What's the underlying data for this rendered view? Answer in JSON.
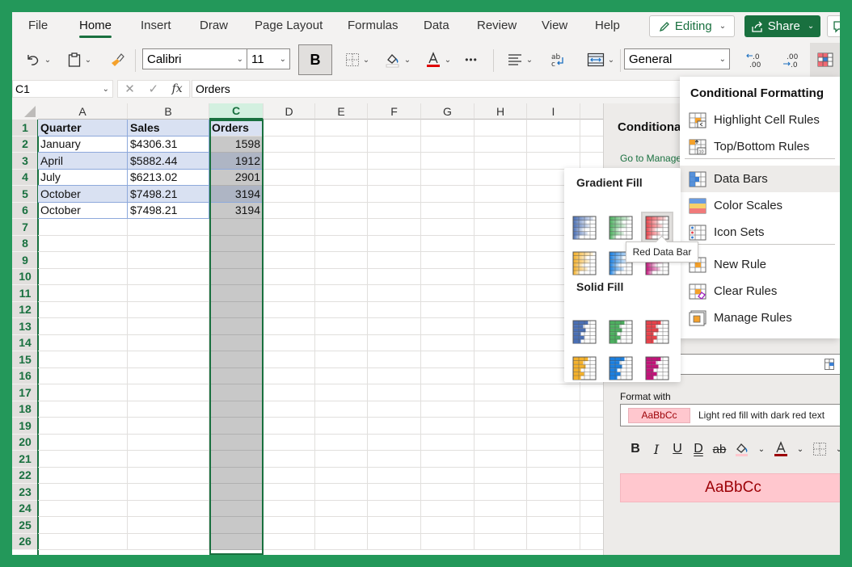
{
  "menubar": {
    "tabs": [
      {
        "label": "File"
      },
      {
        "label": "Home",
        "active": true
      },
      {
        "label": "Insert"
      },
      {
        "label": "Draw"
      },
      {
        "label": "Page Layout"
      },
      {
        "label": "Formulas"
      },
      {
        "label": "Data"
      },
      {
        "label": "Review"
      },
      {
        "label": "View"
      },
      {
        "label": "Help"
      }
    ],
    "editing_label": "Editing",
    "share_label": "Share"
  },
  "toolbar": {
    "font_name": "Calibri",
    "font_size": "11",
    "bold_label": "B",
    "more_label": "•••",
    "number_format": "General",
    "increase_decimal": "←.0 .00",
    "decrease_decimal": ".00 →.0"
  },
  "formula_bar": {
    "name_box": "C1",
    "fx_label": "fx",
    "value": "Orders"
  },
  "sheet": {
    "columns": [
      "A",
      "B",
      "C",
      "D",
      "E",
      "F",
      "G",
      "H",
      "I"
    ],
    "selected_column": "C",
    "row_numbers": [
      "1",
      "2",
      "3",
      "4",
      "5",
      "6",
      "7",
      "8",
      "9",
      "10",
      "11",
      "12",
      "13",
      "14",
      "15",
      "16",
      "17",
      "18",
      "19",
      "20",
      "21",
      "22",
      "23",
      "24",
      "25",
      "26"
    ],
    "header": [
      "Quarter",
      "Sales",
      "Orders"
    ],
    "rows": [
      [
        "January",
        "$4306.31",
        "1598"
      ],
      [
        "April",
        "$5882.44",
        "1912"
      ],
      [
        "July",
        "$6213.02",
        "2901"
      ],
      [
        "October",
        "$7498.21",
        "3194"
      ],
      [
        "October",
        "$7498.21",
        "3194"
      ]
    ]
  },
  "side_pane": {
    "title": "Conditional Formatting",
    "manage_link": "Go to Manage Rules",
    "format_with_label": "Format with",
    "format_swatch": "AaBbCc",
    "format_desc": "Light red fill with dark red text",
    "preview_text": "AaBbCc",
    "colors": {
      "fill": "#ffc7ce",
      "text": "#9c0006"
    }
  },
  "cf_menu": {
    "title": "Conditional Formatting",
    "items": [
      {
        "label": "Highlight Cell Rules",
        "icon": "highlight-cell-rules-icon"
      },
      {
        "label": "Top/Bottom Rules",
        "icon": "top-bottom-rules-icon"
      },
      {
        "label": "Data Bars",
        "icon": "data-bars-icon",
        "hover": true
      },
      {
        "label": "Color Scales",
        "icon": "color-scales-icon"
      },
      {
        "label": "Icon Sets",
        "icon": "icon-sets-icon"
      },
      {
        "label": "New Rule",
        "icon": "new-rule-icon"
      },
      {
        "label": "Clear Rules",
        "icon": "clear-rules-icon"
      },
      {
        "label": "Manage Rules",
        "icon": "manage-rules-icon"
      }
    ]
  },
  "data_bar_gallery": {
    "gradient_title": "Gradient Fill",
    "solid_title": "Solid Fill",
    "gradient": [
      {
        "name": "Blue Data Bar",
        "color": "#4a6fb5"
      },
      {
        "name": "Green Data Bar",
        "color": "#4caf5f"
      },
      {
        "name": "Red Data Bar",
        "color": "#e8424a"
      },
      {
        "name": "Orange Data Bar",
        "color": "#f4b12b"
      },
      {
        "name": "Light Blue Data Bar",
        "color": "#1b7fe0"
      },
      {
        "name": "Purple Data Bar",
        "color": "#c4127a"
      }
    ],
    "solid": [
      {
        "name": "Blue Data Bar",
        "color": "#4a6fb5"
      },
      {
        "name": "Green Data Bar",
        "color": "#4caf5f"
      },
      {
        "name": "Red Data Bar",
        "color": "#e8424a"
      },
      {
        "name": "Orange Data Bar",
        "color": "#f4b12b"
      },
      {
        "name": "Light Blue Data Bar",
        "color": "#1b7fe0"
      },
      {
        "name": "Purple Data Bar",
        "color": "#c4127a"
      }
    ],
    "tooltip": "Red Data Bar"
  },
  "colors": {
    "accent": "#19703f",
    "frame": "#23985a"
  }
}
